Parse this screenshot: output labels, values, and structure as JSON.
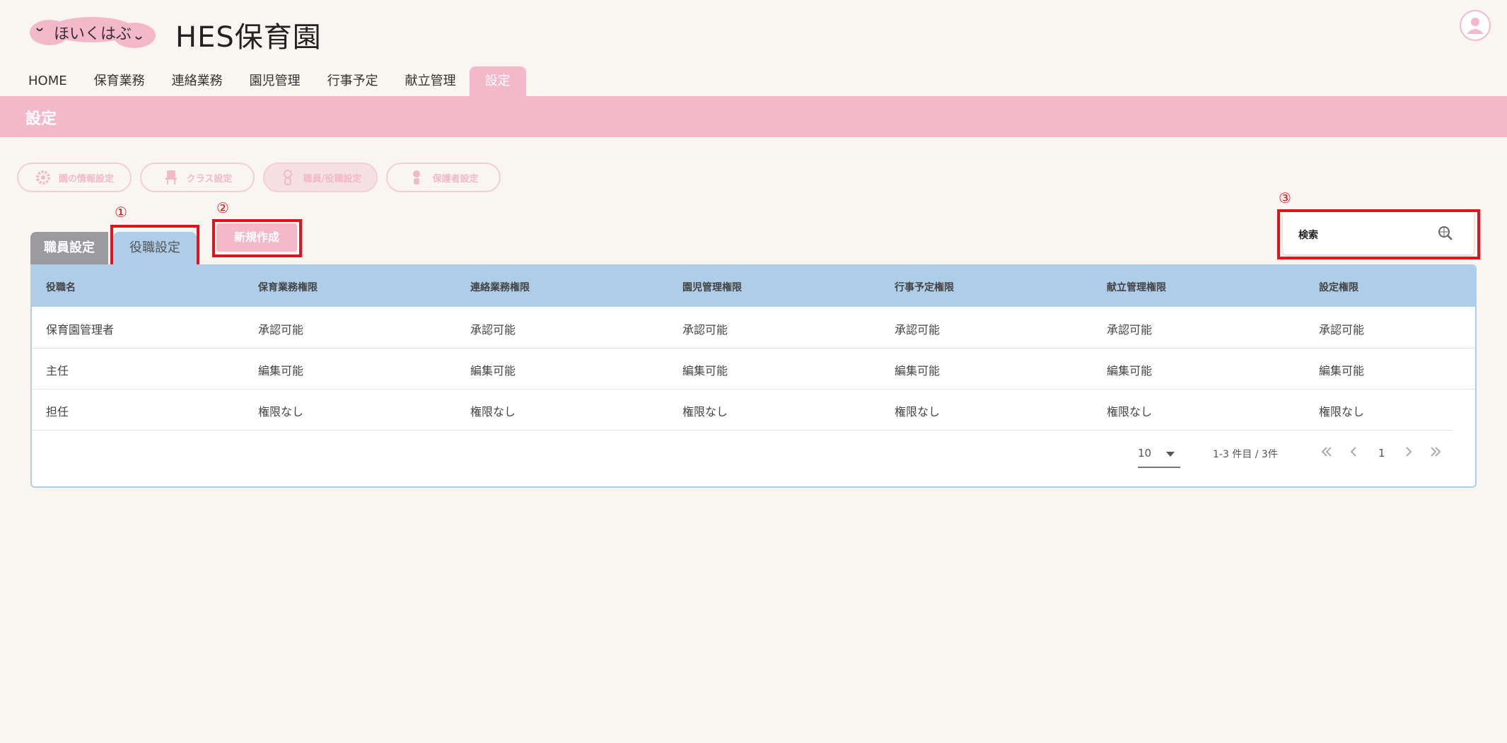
{
  "header": {
    "logo_text": "ほいくはぶ",
    "app_title": "HES保育園"
  },
  "nav": {
    "items": [
      "HOME",
      "保育業務",
      "連絡業務",
      "園児管理",
      "行事予定",
      "献立管理",
      "設定"
    ],
    "active": "設定"
  },
  "section_title": "設定",
  "settings_categories": [
    "園の情報設定",
    "クラス設定",
    "職員/役職設定",
    "保護者設定"
  ],
  "tabs": {
    "staff": "職員設定",
    "role": "役職設定"
  },
  "new_button": "新規作成",
  "annotations": [
    "①",
    "②",
    "③"
  ],
  "search": {
    "label": "検索"
  },
  "table": {
    "headers": [
      "役職名",
      "保育業務権限",
      "連絡業務権限",
      "園児管理権限",
      "行事予定権限",
      "献立管理権限",
      "設定権限"
    ],
    "rows": [
      [
        "保育園管理者",
        "承認可能",
        "承認可能",
        "承認可能",
        "承認可能",
        "承認可能",
        "承認可能"
      ],
      [
        "主任",
        "編集可能",
        "編集可能",
        "編集可能",
        "編集可能",
        "編集可能",
        "編集可能"
      ],
      [
        "担任",
        "権限なし",
        "権限なし",
        "権限なし",
        "権限なし",
        "権限なし",
        "権限なし"
      ]
    ]
  },
  "pagination": {
    "per_page": "10",
    "range": "1-3 件目 / 3件",
    "page": "1"
  },
  "colors": {
    "accent_pink": "#f4b8cb",
    "table_blue": "#aecde9",
    "annotation_red": "#e0141e",
    "tab_gray": "#9b9a9f"
  }
}
